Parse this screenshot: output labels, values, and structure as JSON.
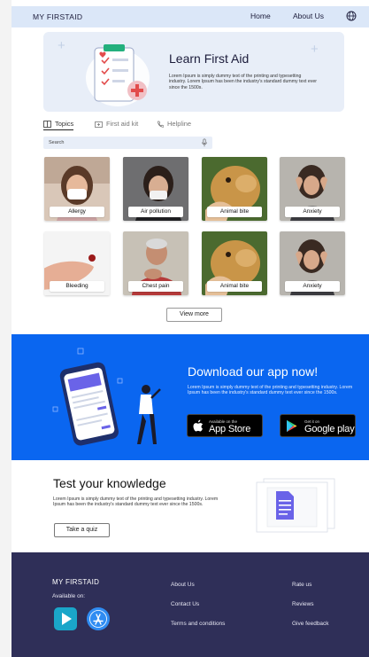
{
  "nav": {
    "brand": "MY FIRSTAID",
    "links": [
      "Home",
      "About Us"
    ],
    "language_icon": "globe-icon"
  },
  "hero": {
    "title": "Learn First Aid",
    "text": "Lorem Ipsum is simply dummy text of the printing and typesetting industry. Lorem Ipsum has been the industry's standard dummy text ever since the 1500s."
  },
  "tabs": [
    {
      "label": "Topics",
      "icon": "book-icon",
      "active": true
    },
    {
      "label": "First aid kit",
      "icon": "first-aid-kit-icon",
      "active": false
    },
    {
      "label": "Helpline",
      "icon": "phone-icon",
      "active": false
    }
  ],
  "search": {
    "placeholder": "Search",
    "icon": "microphone-icon"
  },
  "topics": [
    {
      "label": "Allergy"
    },
    {
      "label": "Air pollution"
    },
    {
      "label": "Animal bite"
    },
    {
      "label": "Anxiety"
    },
    {
      "label": "Bleeding"
    },
    {
      "label": "Chest pain"
    },
    {
      "label": "Animal bite"
    },
    {
      "label": "Anxiety"
    }
  ],
  "view_more": "View more",
  "promo": {
    "title": "Download our app now!",
    "text": "Lorem Ipsum is simply dummy text of the printing and typesetting industry. Lorem Ipsum has been the industry's standard dummy text ever since the 1500s.",
    "app_store": {
      "small": "Available on the",
      "big": "App Store"
    },
    "google_play": {
      "small": "Get it on",
      "big": "Google play"
    }
  },
  "knowledge": {
    "title": "Test your knowledge",
    "text": "Lorem Ipsum is simply dummy text of the printing and typesetting industry. Lorem Ipsum has been the industry's standard dummy text ever since the 1500s.",
    "button": "Take a quiz"
  },
  "footer": {
    "brand": "MY FIRSTAID",
    "available": "Available on:",
    "col1": [
      "About Us",
      "Contact Us",
      "Terms and conditions"
    ],
    "col2": [
      "Rate us",
      "Reviews",
      "Give feedback"
    ]
  },
  "colors": {
    "nav_bg": "#dbe7f8",
    "promo_bg": "#0a66f0",
    "footer_bg": "#2f2f58",
    "accent_purple": "#6a63e8"
  }
}
